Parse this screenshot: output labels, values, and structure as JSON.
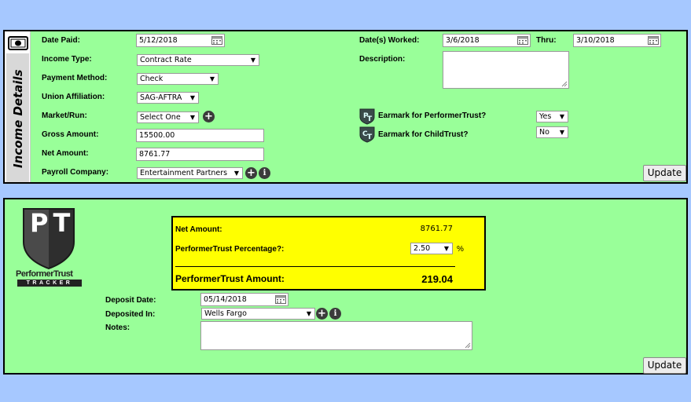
{
  "income": {
    "sidebar_title": "Income Details",
    "date_paid": {
      "label": "Date Paid:",
      "value": "5/12/2018"
    },
    "income_type": {
      "label": "Income Type:",
      "value": "Contract Rate"
    },
    "payment_method": {
      "label": "Payment Method:",
      "value": "Check"
    },
    "union_affiliation": {
      "label": "Union Affiliation:",
      "value": "SAG-AFTRA"
    },
    "market_run": {
      "label": "Market/Run:",
      "value": "Select One"
    },
    "gross_amount": {
      "label": "Gross Amount:",
      "value": "15500.00"
    },
    "net_amount": {
      "label": "Net Amount:",
      "value": "8761.77"
    },
    "payroll_company": {
      "label": "Payroll Company:",
      "value": "Entertainment Partners"
    },
    "dates_worked": {
      "label": "Date(s) Worked:",
      "from": "3/6/2018",
      "thru_label": "Thru:",
      "to": "3/10/2018"
    },
    "description": {
      "label": "Description:",
      "value": ""
    },
    "earmark_pt": {
      "label": "Earmark for PerformerTrust?",
      "value": "Yes"
    },
    "earmark_ct": {
      "label": "Earmark for ChildTrust?",
      "value": "No"
    },
    "update_label": "Update"
  },
  "tracker": {
    "logo_letters": "PT",
    "logo_name": "PerformerTrust",
    "logo_sub": "TRACKER",
    "summary": {
      "net_label": "Net Amount:",
      "net_value": "8761.77",
      "pct_label": "PerformerTrust Percentage?:",
      "pct_value": "2.50",
      "pct_unit": "%",
      "amount_label": "PerformerTrust Amount:",
      "amount_value": "219.04"
    },
    "deposit_date": {
      "label": "Deposit Date:",
      "value": "05/14/2018"
    },
    "deposited_in": {
      "label": "Deposited In:",
      "value": "Wells Fargo"
    },
    "notes": {
      "label": "Notes:",
      "value": ""
    },
    "update_label": "Update"
  },
  "icons": {
    "plus": "+",
    "info": "i",
    "arrow": "▼"
  }
}
